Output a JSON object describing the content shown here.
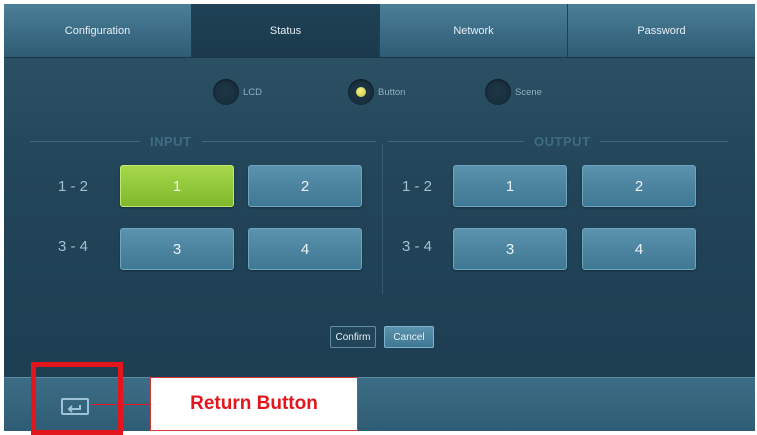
{
  "tabs": [
    {
      "label": "Configuration",
      "active": false
    },
    {
      "label": "Status",
      "active": true
    },
    {
      "label": "Network",
      "active": false
    },
    {
      "label": "Password",
      "active": false
    }
  ],
  "modes": [
    {
      "label": "LCD",
      "selected": false
    },
    {
      "label": "Button",
      "selected": true
    },
    {
      "label": "Scene",
      "selected": false
    }
  ],
  "input": {
    "title": "INPUT",
    "row1_label": "1 - 2",
    "row2_label": "3 - 4",
    "buttons": [
      "1",
      "2",
      "3",
      "4"
    ],
    "selected": "1"
  },
  "output": {
    "title": "OUTPUT",
    "row1_label": "1 - 2",
    "row2_label": "3 - 4",
    "buttons": [
      "1",
      "2",
      "3",
      "4"
    ]
  },
  "actions": {
    "confirm": "Confirm",
    "cancel": "Cancel"
  },
  "footer": {
    "return_icon": "return-icon"
  },
  "annotation": {
    "label": "Return Button",
    "color": "#e2161c"
  },
  "colors": {
    "selected_button": "#8cc63f",
    "button": "#4a86a3",
    "tab_active": "#1f4256"
  }
}
